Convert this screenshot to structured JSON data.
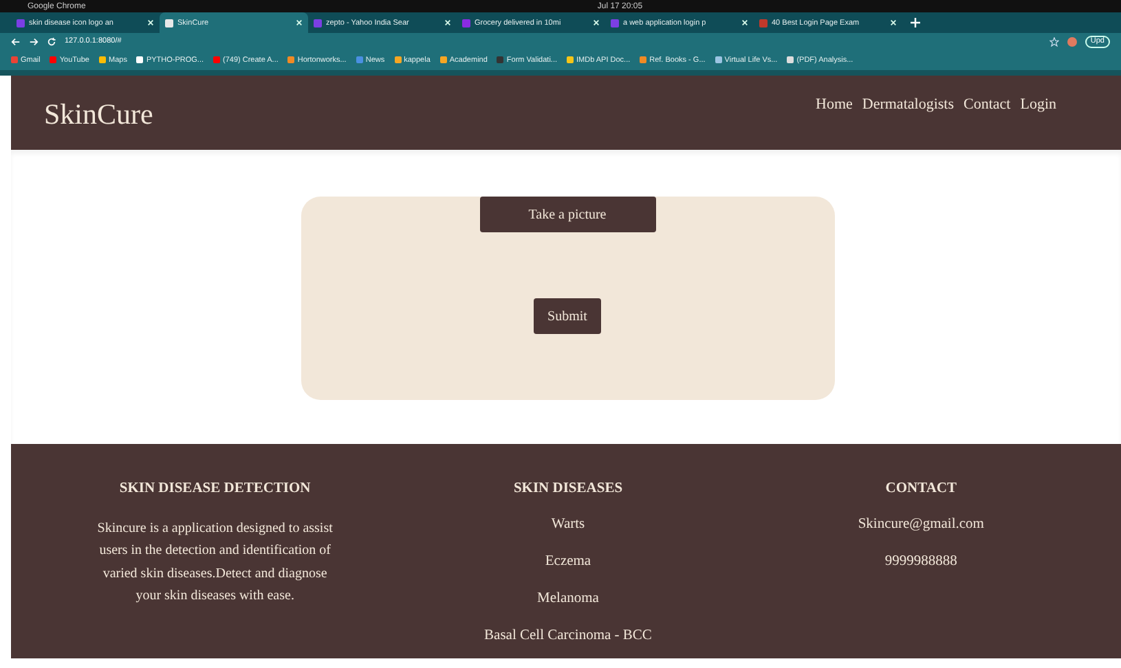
{
  "os_bar": {
    "app": "Google Chrome",
    "clock": "Jul 17 20:05"
  },
  "tabs": [
    {
      "label": "skin disease icon logo an",
      "selected": false
    },
    {
      "label": "SkinCure",
      "selected": true
    },
    {
      "label": "zepto - Yahoo India Sear",
      "selected": false
    },
    {
      "label": "Grocery delivered in 10mi",
      "selected": false
    },
    {
      "label": "a web application login p",
      "selected": false
    },
    {
      "label": "40 Best Login Page Exam",
      "selected": false
    }
  ],
  "address_bar": {
    "url": "127.0.0.1:8080/#",
    "update_button": "Upd"
  },
  "bookmarks": [
    "Gmail",
    "YouTube",
    "Maps",
    "PYTHO-PROG...",
    "(749) Create A...",
    "Hortonworks...",
    "News",
    "kappela",
    "Academind",
    "Form Validati...",
    "IMDb API Doc...",
    "Ref. Books - G...",
    "Virtual Life Vs...",
    "(PDF) Analysis..."
  ],
  "header": {
    "brand": "SkinCure",
    "nav": [
      "Home",
      "Dermatalogists",
      "Contact",
      "Login"
    ]
  },
  "upload_card": {
    "picture_button": "Take a picture",
    "submit_button": "Submit"
  },
  "footer": {
    "about": {
      "title": "SKIN DISEASE DETECTION",
      "text": "Skincure is a application designed to assist users in the detection and identification of varied skin diseases.Detect and diagnose your skin diseases with ease."
    },
    "diseases": {
      "title": "SKIN DISEASES",
      "items": [
        "Warts",
        "Eczema",
        "Melanoma",
        "Basal Cell Carcinoma - BCC"
      ]
    },
    "contact": {
      "title": "CONTACT",
      "items": [
        "Skincure@gmail.com",
        "9999988888"
      ]
    }
  }
}
